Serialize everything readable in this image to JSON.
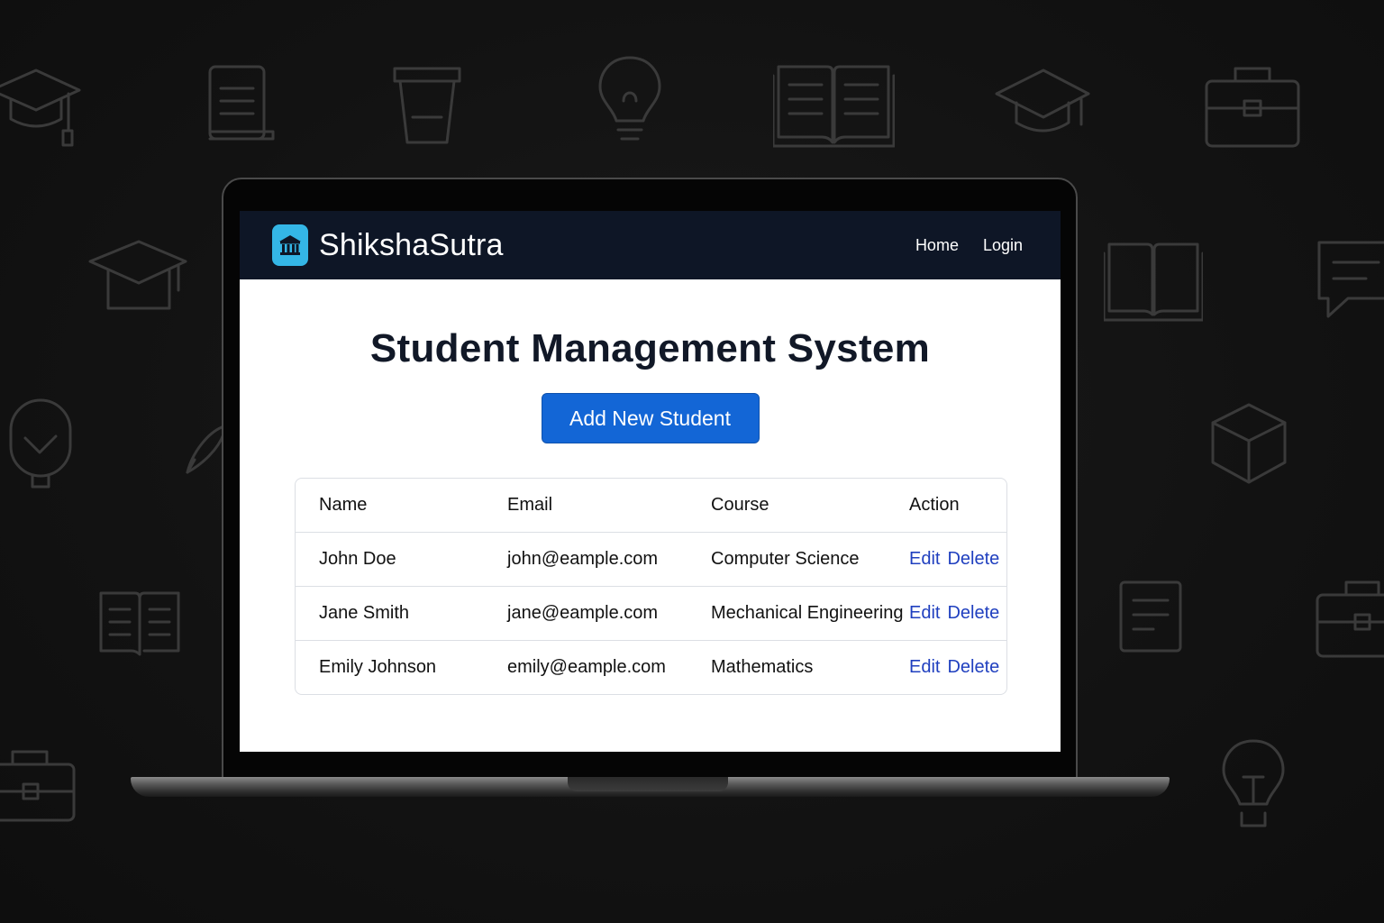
{
  "app": {
    "brand": "ShikshaSutra",
    "brand_icon": "bank-icon",
    "accent_color": "#1366d6",
    "navbar_color": "#0e1626",
    "logo_color": "#34b6e6"
  },
  "nav": {
    "links": [
      "Home",
      "Login"
    ]
  },
  "main": {
    "title": "Student Management System",
    "add_button_label": "Add New Student"
  },
  "table": {
    "columns": [
      "Name",
      "Email",
      "Course",
      "Action"
    ],
    "rows": [
      {
        "name": "John Doe",
        "email": "john@eample.com",
        "course": "Computer Science",
        "actions": [
          "Edit",
          "Delete"
        ]
      },
      {
        "name": "Jane Smith",
        "email": "jane@eample.com",
        "course": "Mechanical Engineering",
        "actions": [
          "Edit",
          "Delete"
        ]
      },
      {
        "name": "Emily Johnson",
        "email": "emily@eample.com",
        "course": "Mathematics",
        "actions": [
          "Edit",
          "Delete"
        ]
      }
    ]
  },
  "background_icons": [
    "graduation-cap-icon",
    "scroll-icon",
    "cup-icon",
    "lightbulb-icon",
    "open-book-icon",
    "graduation-cap-icon",
    "briefcase-icon",
    "document-icon",
    "chat-icon",
    "microphone-icon",
    "pen-icon",
    "box-icon"
  ]
}
